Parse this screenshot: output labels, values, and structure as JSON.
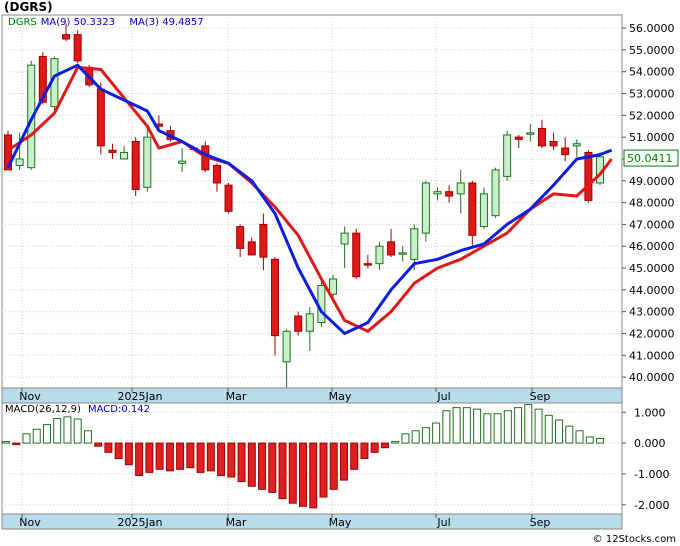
{
  "header": {
    "ticker": "(DGRS)"
  },
  "footer": {
    "credit": "© 12Stocks.com"
  },
  "chart_data": [
    {
      "type": "candlestick",
      "legend": [
        {
          "label": "DGRS",
          "color": "#008000"
        },
        {
          "label": "MA(9)",
          "value": "50.3323",
          "color": "#0000cc"
        },
        {
          "label": "MA(3)",
          "value": "49.4857",
          "color": "#0000cc"
        }
      ],
      "last_price_label": "50.0411",
      "ylim": [
        39.5,
        56.6
      ],
      "yticks": [
        "56.0000",
        "55.0000",
        "54.0000",
        "53.0000",
        "52.0000",
        "51.0000",
        "50.0000",
        "49.0000",
        "48.0000",
        "47.0000",
        "46.0000",
        "45.0000",
        "44.0000",
        "43.0000",
        "42.0000",
        "41.0000",
        "40.0000"
      ],
      "x_labels": [
        "Nov",
        "2025Jan",
        "Mar",
        "May",
        "Jul",
        "Sep"
      ],
      "candles": [
        {
          "o": 51.1,
          "h": 51.3,
          "l": 49.5,
          "c": 49.5,
          "up": false
        },
        {
          "o": 49.7,
          "h": 51.2,
          "l": 49.5,
          "c": 50.0,
          "up": true
        },
        {
          "o": 49.6,
          "h": 54.5,
          "l": 49.5,
          "c": 54.3,
          "up": true
        },
        {
          "o": 54.7,
          "h": 54.9,
          "l": 52.5,
          "c": 52.6,
          "up": false
        },
        {
          "o": 52.4,
          "h": 54.7,
          "l": 52.0,
          "c": 54.6,
          "up": true
        },
        {
          "o": 55.7,
          "h": 56.2,
          "l": 55.4,
          "c": 55.5,
          "up": false
        },
        {
          "o": 55.7,
          "h": 55.9,
          "l": 54.4,
          "c": 54.5,
          "up": false
        },
        {
          "o": 54.2,
          "h": 54.3,
          "l": 53.3,
          "c": 53.4,
          "up": false
        },
        {
          "o": 53.2,
          "h": 53.5,
          "l": 50.2,
          "c": 50.6,
          "up": false
        },
        {
          "o": 50.4,
          "h": 50.7,
          "l": 50.0,
          "c": 50.3,
          "up": false
        },
        {
          "o": 50.0,
          "h": 50.6,
          "l": 50.0,
          "c": 50.3,
          "up": true
        },
        {
          "o": 50.8,
          "h": 51.0,
          "l": 48.3,
          "c": 48.6,
          "up": false
        },
        {
          "o": 48.7,
          "h": 51.5,
          "l": 48.5,
          "c": 51.0,
          "up": true
        },
        {
          "o": 51.6,
          "h": 52.0,
          "l": 51.4,
          "c": 51.5,
          "up": false
        },
        {
          "o": 51.3,
          "h": 51.5,
          "l": 50.8,
          "c": 50.9,
          "up": false
        },
        {
          "o": 49.8,
          "h": 50.5,
          "l": 49.4,
          "c": 49.9,
          "up": true
        },
        {
          "o": 50.5,
          "h": 50.6,
          "l": 50.4,
          "c": 50.5,
          "up": false
        },
        {
          "o": 50.6,
          "h": 50.8,
          "l": 49.4,
          "c": 49.5,
          "up": false
        },
        {
          "o": 49.7,
          "h": 49.8,
          "l": 48.5,
          "c": 48.9,
          "up": false
        },
        {
          "o": 48.8,
          "h": 48.9,
          "l": 47.5,
          "c": 47.6,
          "up": false
        },
        {
          "o": 46.9,
          "h": 47.0,
          "l": 45.5,
          "c": 45.9,
          "up": false
        },
        {
          "o": 46.2,
          "h": 46.4,
          "l": 45.6,
          "c": 45.6,
          "up": false
        },
        {
          "o": 47.0,
          "h": 47.5,
          "l": 44.9,
          "c": 45.5,
          "up": false
        },
        {
          "o": 45.4,
          "h": 45.5,
          "l": 41.0,
          "c": 41.9,
          "up": false
        },
        {
          "o": 40.7,
          "h": 42.2,
          "l": 39.5,
          "c": 42.1,
          "up": true
        },
        {
          "o": 42.8,
          "h": 43.0,
          "l": 41.9,
          "c": 42.1,
          "up": false
        },
        {
          "o": 42.1,
          "h": 43.2,
          "l": 41.2,
          "c": 42.9,
          "up": true
        },
        {
          "o": 42.5,
          "h": 44.5,
          "l": 42.3,
          "c": 44.2,
          "up": true
        },
        {
          "o": 43.8,
          "h": 44.7,
          "l": 43.6,
          "c": 44.5,
          "up": true
        },
        {
          "o": 46.1,
          "h": 46.9,
          "l": 45.0,
          "c": 46.6,
          "up": true
        },
        {
          "o": 46.6,
          "h": 46.8,
          "l": 44.5,
          "c": 44.6,
          "up": false
        },
        {
          "o": 45.2,
          "h": 45.6,
          "l": 45.0,
          "c": 45.2,
          "up": false
        },
        {
          "o": 45.2,
          "h": 46.2,
          "l": 44.9,
          "c": 46.0,
          "up": true
        },
        {
          "o": 46.2,
          "h": 46.8,
          "l": 45.5,
          "c": 45.6,
          "up": false
        },
        {
          "o": 45.7,
          "h": 46.0,
          "l": 45.3,
          "c": 45.7,
          "up": true
        },
        {
          "o": 45.4,
          "h": 47.0,
          "l": 44.9,
          "c": 46.8,
          "up": true
        },
        {
          "o": 46.6,
          "h": 49.0,
          "l": 46.2,
          "c": 48.9,
          "up": true
        },
        {
          "o": 48.4,
          "h": 48.7,
          "l": 48.1,
          "c": 48.5,
          "up": true
        },
        {
          "o": 48.5,
          "h": 48.8,
          "l": 48.0,
          "c": 48.3,
          "up": false
        },
        {
          "o": 48.9,
          "h": 49.5,
          "l": 47.5,
          "c": 48.4,
          "up": true
        },
        {
          "o": 48.9,
          "h": 49.0,
          "l": 46.0,
          "c": 46.5,
          "up": false
        },
        {
          "o": 46.9,
          "h": 48.7,
          "l": 46.8,
          "c": 48.4,
          "up": true
        },
        {
          "o": 47.4,
          "h": 49.6,
          "l": 47.3,
          "c": 49.5,
          "up": true
        },
        {
          "o": 49.2,
          "h": 51.3,
          "l": 49.0,
          "c": 51.1,
          "up": true
        },
        {
          "o": 51.0,
          "h": 51.1,
          "l": 50.5,
          "c": 50.9,
          "up": false
        },
        {
          "o": 51.2,
          "h": 51.6,
          "l": 50.8,
          "c": 51.2,
          "up": true
        },
        {
          "o": 51.4,
          "h": 51.8,
          "l": 50.5,
          "c": 50.6,
          "up": false
        },
        {
          "o": 50.8,
          "h": 51.2,
          "l": 50.4,
          "c": 50.6,
          "up": false
        },
        {
          "o": 50.5,
          "h": 51.0,
          "l": 49.9,
          "c": 50.2,
          "up": false
        },
        {
          "o": 50.7,
          "h": 50.9,
          "l": 50.1,
          "c": 50.6,
          "up": true
        },
        {
          "o": 50.3,
          "h": 50.4,
          "l": 48.0,
          "c": 48.1,
          "up": false
        },
        {
          "o": 48.9,
          "h": 50.3,
          "l": 48.8,
          "c": 50.1,
          "up": true
        }
      ],
      "ma9": [
        {
          "i": 0,
          "v": 49.6
        },
        {
          "i": 2,
          "v": 51.8
        },
        {
          "i": 4,
          "v": 53.8
        },
        {
          "i": 6,
          "v": 54.3
        },
        {
          "i": 8,
          "v": 53.2
        },
        {
          "i": 10,
          "v": 52.7
        },
        {
          "i": 12,
          "v": 52.2
        },
        {
          "i": 13,
          "v": 51.3
        },
        {
          "i": 15,
          "v": 50.8
        },
        {
          "i": 17,
          "v": 50.2
        },
        {
          "i": 19,
          "v": 49.8
        },
        {
          "i": 21,
          "v": 49.0
        },
        {
          "i": 23,
          "v": 47.5
        },
        {
          "i": 25,
          "v": 45.0
        },
        {
          "i": 27,
          "v": 43.0
        },
        {
          "i": 29,
          "v": 42.0
        },
        {
          "i": 31,
          "v": 42.5
        },
        {
          "i": 33,
          "v": 44.0
        },
        {
          "i": 35,
          "v": 45.2
        },
        {
          "i": 37,
          "v": 45.4
        },
        {
          "i": 39,
          "v": 45.8
        },
        {
          "i": 41,
          "v": 46.1
        },
        {
          "i": 43,
          "v": 47.0
        },
        {
          "i": 45,
          "v": 47.7
        },
        {
          "i": 47,
          "v": 48.8
        },
        {
          "i": 49,
          "v": 50.0
        },
        {
          "i": 51,
          "v": 50.2
        },
        {
          "i": 52,
          "v": 50.4
        }
      ],
      "ma3": [
        {
          "i": 0,
          "v": 50.4
        },
        {
          "i": 2,
          "v": 51.1
        },
        {
          "i": 4,
          "v": 52.1
        },
        {
          "i": 6,
          "v": 54.2
        },
        {
          "i": 8,
          "v": 54.1
        },
        {
          "i": 10,
          "v": 52.8
        },
        {
          "i": 12,
          "v": 51.5
        },
        {
          "i": 13,
          "v": 50.5
        },
        {
          "i": 15,
          "v": 50.8
        },
        {
          "i": 17,
          "v": 50.1
        },
        {
          "i": 19,
          "v": 49.8
        },
        {
          "i": 21,
          "v": 48.9
        },
        {
          "i": 23,
          "v": 47.8
        },
        {
          "i": 25,
          "v": 46.5
        },
        {
          "i": 27,
          "v": 44.5
        },
        {
          "i": 29,
          "v": 42.6
        },
        {
          "i": 31,
          "v": 42.1
        },
        {
          "i": 33,
          "v": 43.0
        },
        {
          "i": 35,
          "v": 44.3
        },
        {
          "i": 37,
          "v": 45.0
        },
        {
          "i": 39,
          "v": 45.4
        },
        {
          "i": 41,
          "v": 46.0
        },
        {
          "i": 43,
          "v": 46.6
        },
        {
          "i": 45,
          "v": 47.7
        },
        {
          "i": 47,
          "v": 48.4
        },
        {
          "i": 49,
          "v": 48.3
        },
        {
          "i": 51,
          "v": 49.3
        },
        {
          "i": 52,
          "v": 50.0
        }
      ]
    },
    {
      "type": "bar",
      "title": "MACD(26,12,9)",
      "value_label": "MACD:0.142",
      "ylim": [
        -2.3,
        1.3
      ],
      "yticks": [
        "1.000",
        "0.000",
        "-1.000",
        "-2.000"
      ],
      "x_labels": [
        "Nov",
        "2025Jan",
        "Mar",
        "May",
        "Jul",
        "Sep"
      ],
      "values": [
        0.05,
        -0.05,
        0.3,
        0.45,
        0.6,
        0.8,
        0.85,
        0.78,
        0.4,
        -0.1,
        -0.3,
        -0.5,
        -0.7,
        -1.05,
        -0.95,
        -0.85,
        -0.9,
        -0.85,
        -0.8,
        -0.95,
        -0.9,
        -1.05,
        -1.1,
        -1.25,
        -1.4,
        -1.5,
        -1.6,
        -1.8,
        -1.95,
        -2.05,
        -2.1,
        -1.75,
        -1.5,
        -1.2,
        -0.85,
        -0.5,
        -0.3,
        -0.15,
        0.05,
        0.3,
        0.4,
        0.5,
        0.65,
        1.05,
        1.15,
        1.15,
        1.1,
        0.95,
        0.95,
        1.05,
        1.15,
        1.25,
        1.1,
        0.9,
        0.75,
        0.55,
        0.4,
        0.2,
        0.15
      ],
      "colors": {
        "positive": "#ffffff",
        "negative": "#e02020",
        "pos_border": "#207020",
        "neg_border": "#a00000"
      }
    }
  ],
  "colors": {
    "up_fill": "#c8f0c8",
    "up_border": "#207020",
    "down_fill": "#e01818",
    "down_border": "#a00000",
    "ma9": "#0a1ee0",
    "ma3": "#e01818",
    "axis_band": "#b8dcea",
    "grid": "#cccccc"
  }
}
